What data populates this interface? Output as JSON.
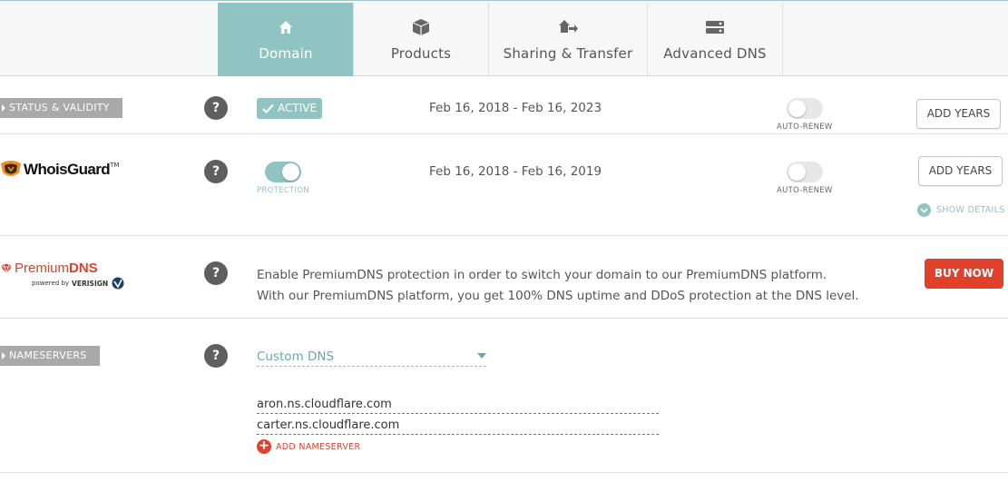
{
  "tabs": [
    {
      "label": "Domain",
      "icon": "home-icon",
      "active": true
    },
    {
      "label": "Products",
      "icon": "box-icon",
      "active": false
    },
    {
      "label": "Sharing & Transfer",
      "icon": "transfer-icon",
      "active": false
    },
    {
      "label": "Advanced DNS",
      "icon": "server-icon",
      "active": false
    }
  ],
  "status": {
    "ribbon": "STATUS & VALIDITY",
    "badge": "ACTIVE",
    "dates": "Feb 16, 2018 - Feb 16, 2023",
    "autorenew_label": "AUTO-RENEW",
    "autorenew_on": false,
    "add_years": "ADD YEARS"
  },
  "whoisguard": {
    "logo_text": "WhoisGuard",
    "logo_tm": "TM",
    "protection_label": "PROTECTION",
    "protection_on": true,
    "dates": "Feb 16, 2018 - Feb 16, 2019",
    "autorenew_label": "AUTO-RENEW",
    "autorenew_on": false,
    "add_years": "ADD YEARS",
    "show_details": "SHOW DETAILS"
  },
  "premiumdns": {
    "logo_premium": "Premium",
    "logo_dns": "DNS",
    "logo_powered": "powered by",
    "logo_verisign": "VERISIGN",
    "line1": "Enable PremiumDNS protection in order to switch your domain to our PremiumDNS platform.",
    "line2": "With our PremiumDNS platform, you get 100% DNS uptime and DDoS protection at the DNS level.",
    "buy": "BUY NOW"
  },
  "nameservers": {
    "ribbon": "NAMESERVERS",
    "dns_type": "Custom DNS",
    "servers": [
      "aron.ns.cloudflare.com",
      "carter.ns.cloudflare.com"
    ],
    "add_label": "ADD NAMESERVER"
  },
  "help_glyph": "?",
  "colors": {
    "teal": "#8fc4c2",
    "red": "#e1402a",
    "ribbon": "#a9a9a9"
  }
}
